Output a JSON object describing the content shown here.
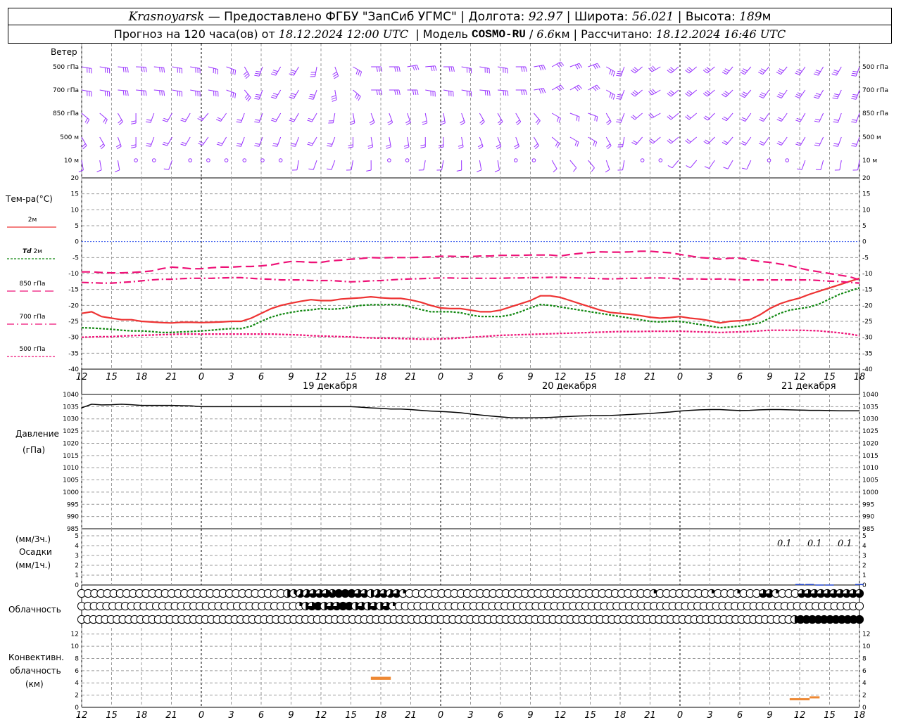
{
  "header": {
    "city": "Krasnoyarsk",
    "provider": " — Предоставлено ФГБУ \"ЗапСиб УГМС\" | Долгота: ",
    "lon": "92.97",
    "lat_label": " | Широта: ",
    "lat": "56.021",
    "alt_label": " | Высота: ",
    "alt": "189",
    "alt_unit": "м",
    "forecast_label": "Прогноз на 120 часа(ов) от ",
    "forecast_from": "18.12.2024 12:00 UTC",
    "model_label": "  | Модель ",
    "model": "COSMO-RU",
    "model_res_sep": " / ",
    "model_res": "6.6",
    "model_res_unit": "км",
    "computed_label": " | Рассчитано: ",
    "computed": "18.12.2024 16:46 UTC"
  },
  "wind_panel": {
    "title": "Ветер",
    "levels": [
      "500 гПа",
      "700 гПа",
      "850 гПа",
      "500 м",
      "10  м"
    ],
    "colors": {
      "barbs": "#9933ff"
    }
  },
  "temp_panel": {
    "title": "Тем-ра(°С)",
    "legend": [
      {
        "label": "2м",
        "color": "#ee3333",
        "dash": ""
      },
      {
        "label_italic": "Td",
        "label": " 2м",
        "color": "#118811",
        "dash": "3,2"
      },
      {
        "label": "850 гПа",
        "color": "#ee1177",
        "dash": "12,6"
      },
      {
        "label": "700 гПа",
        "color": "#ee1177",
        "dash": "10,4,2,4"
      },
      {
        "label": "500 гПа",
        "color": "#ee1177",
        "dash": "3,2"
      }
    ],
    "yticks": [
      "20",
      "15",
      "10",
      "5",
      "0",
      "-5",
      "-10",
      "-15",
      "-20",
      "-25",
      "-30",
      "-35",
      "-40"
    ]
  },
  "day_labels": [
    "19 декабря",
    "20 декабря",
    "21 декабря"
  ],
  "xticks": [
    "12",
    "15",
    "18",
    "21",
    "0",
    "3",
    "6",
    "9",
    "12",
    "15",
    "18",
    "21",
    "0",
    "3",
    "6",
    "9",
    "12",
    "15",
    "18",
    "21",
    "0",
    "3",
    "6",
    "9",
    "12",
    "15",
    "18"
  ],
  "pressure_panel": {
    "title": "Давление",
    "unit": "(гПа)",
    "yticks": [
      "1040",
      "1035",
      "1030",
      "1025",
      "1020",
      "1015",
      "1010",
      "1005",
      "1000",
      "995",
      "990",
      "985"
    ]
  },
  "precip_panel": {
    "unit_top": "(мм/3ч.)",
    "title": "Осадки",
    "unit_bottom": "(мм/1ч.)",
    "yticks": [
      "5",
      "4",
      "3",
      "2",
      "1",
      "0"
    ],
    "labels": [
      "0.1",
      "0.1",
      "0.1"
    ]
  },
  "cloud_panel": {
    "title": "Облачность"
  },
  "conv_panel": {
    "title_1": "Конвективн.",
    "title_2": "облачность",
    "unit": "(км)",
    "yticks": [
      "12",
      "10",
      "8",
      "6",
      "4",
      "2",
      "0"
    ]
  },
  "chart_data": {
    "type": "line",
    "x_hours": [
      0,
      1,
      2,
      3,
      4,
      5,
      6,
      7,
      8,
      9,
      10,
      11,
      12,
      13,
      14,
      15,
      16,
      17,
      18,
      19,
      20,
      21,
      22,
      23,
      24,
      25,
      26,
      27,
      28,
      29,
      30,
      31,
      32,
      33,
      34,
      35,
      36,
      37,
      38,
      39,
      40,
      41,
      42,
      43,
      44,
      45,
      46,
      47,
      48,
      49,
      50,
      51,
      52,
      53,
      54,
      55,
      56,
      57,
      58,
      59,
      60,
      61,
      62,
      63,
      64,
      65,
      66,
      67,
      68,
      69,
      70,
      71,
      72,
      73,
      74,
      75,
      76,
      77,
      78
    ],
    "series": [
      {
        "name": "2м",
        "values": [
          -22.5,
          -22,
          -23.5,
          -24,
          -24.5,
          -24.5,
          -25,
          -25.2,
          -25.4,
          -25.5,
          -25.3,
          -25.3,
          -25.4,
          -25.3,
          -25.2,
          -25,
          -25,
          -24,
          -22.5,
          -21,
          -20,
          -19.3,
          -18.7,
          -18.2,
          -18.5,
          -18.5,
          -18,
          -17.8,
          -17.6,
          -17.3,
          -17.6,
          -17.8,
          -17.8,
          -18.3,
          -19,
          -20,
          -20.8,
          -21,
          -21,
          -21.5,
          -22,
          -22,
          -21.5,
          -20.5,
          -19.5,
          -18.5,
          -17,
          -17,
          -17.5,
          -18.5,
          -19.5,
          -20.5,
          -21.5,
          -22.2,
          -22.5,
          -22.8,
          -23.2,
          -23.7,
          -24,
          -23.8,
          -23.5,
          -24,
          -24.3,
          -24.8,
          -25.5,
          -25,
          -24.8,
          -24.5,
          -23,
          -21,
          -19.5,
          -18.5,
          -17.7,
          -16.5,
          -15.5,
          -14.5,
          -13.5,
          -12.5,
          -11.5
        ],
        "color": "#ee3333"
      },
      {
        "name": "Td 2м",
        "values": [
          -27,
          -27.1,
          -27.3,
          -27.5,
          -27.8,
          -28,
          -28,
          -28.2,
          -28.5,
          -28.5,
          -28.3,
          -28.2,
          -28,
          -27.8,
          -27.5,
          -27.3,
          -27.3,
          -26.5,
          -25,
          -23.7,
          -22.8,
          -22.2,
          -21.7,
          -21.4,
          -21,
          -21.2,
          -21,
          -20.5,
          -20,
          -19.8,
          -19.8,
          -19.7,
          -19.8,
          -20.5,
          -21.3,
          -22,
          -22,
          -22,
          -22.3,
          -23,
          -23.5,
          -23.5,
          -23.5,
          -23,
          -22,
          -20.8,
          -19.7,
          -20,
          -20.5,
          -21,
          -21.5,
          -22,
          -22.5,
          -23,
          -23.5,
          -24,
          -24.5,
          -25,
          -25.2,
          -25,
          -25,
          -25.5,
          -26,
          -26.5,
          -27,
          -26.8,
          -26.5,
          -26,
          -25.5,
          -24,
          -22.5,
          -21.5,
          -21,
          -20.5,
          -19.5,
          -18,
          -16.5,
          -15.5,
          -14.5
        ],
        "color": "#118811"
      },
      {
        "name": "850 гПа",
        "values": [
          -9.5,
          -9.5,
          -9.7,
          -9.8,
          -9.8,
          -9.7,
          -9.5,
          -9.2,
          -8.5,
          -8,
          -8.2,
          -8.5,
          -8.5,
          -8.2,
          -8,
          -8,
          -7.8,
          -7.8,
          -7.6,
          -7.3,
          -6.7,
          -6.2,
          -6.3,
          -6.5,
          -6.5,
          -6,
          -5.8,
          -5.5,
          -5.3,
          -5,
          -5.1,
          -5,
          -5,
          -5,
          -4.9,
          -4.8,
          -4.6,
          -4.6,
          -4.7,
          -4.7,
          -4.5,
          -4.5,
          -4.3,
          -4.3,
          -4.3,
          -4.2,
          -4.2,
          -4.2,
          -4.5,
          -4,
          -3.7,
          -3.4,
          -3.2,
          -3.3,
          -3.3,
          -3.2,
          -3,
          -3,
          -3.3,
          -3.5,
          -4,
          -4.5,
          -5,
          -5.2,
          -5.5,
          -5.2,
          -5.2,
          -5.7,
          -6.2,
          -6.5,
          -7,
          -7.5,
          -8.3,
          -9,
          -9.5,
          -10,
          -10.5,
          -11,
          -12
        ],
        "color": "#ee1177"
      },
      {
        "name": "700 гПа",
        "values": [
          -12.8,
          -12.9,
          -13,
          -13,
          -12.8,
          -12.6,
          -12.3,
          -12,
          -11.8,
          -11.8,
          -11.6,
          -11.5,
          -11.5,
          -11.5,
          -11.4,
          -11.3,
          -11.3,
          -11.5,
          -11.7,
          -11.8,
          -12,
          -12,
          -12,
          -12.2,
          -12.2,
          -12.2,
          -12.4,
          -12.6,
          -12.5,
          -12.3,
          -12.2,
          -12,
          -11.8,
          -11.7,
          -11.6,
          -11.5,
          -11.4,
          -11.4,
          -11.5,
          -11.5,
          -11.5,
          -11.5,
          -11.5,
          -11.4,
          -11.4,
          -11.3,
          -11.3,
          -11.2,
          -11.2,
          -11.3,
          -11.4,
          -11.5,
          -11.6,
          -11.7,
          -11.6,
          -11.5,
          -11.5,
          -11.4,
          -11.4,
          -11.5,
          -11.7,
          -11.7,
          -11.7,
          -11.8,
          -11.7,
          -11.8,
          -12,
          -12,
          -12,
          -12,
          -12,
          -12,
          -12,
          -12,
          -12.2,
          -12.4,
          -12.5,
          -12.8,
          -13
        ],
        "color": "#ee1177"
      },
      {
        "name": "500 гПа",
        "values": [
          -30,
          -29.9,
          -29.8,
          -29.8,
          -29.6,
          -29.5,
          -29.4,
          -29.3,
          -29.2,
          -29.1,
          -29,
          -29,
          -29,
          -29,
          -29,
          -29,
          -29,
          -29,
          -29,
          -29,
          -29.1,
          -29.2,
          -29.3,
          -29.5,
          -29.6,
          -29.7,
          -29.8,
          -29.9,
          -30.1,
          -30.2,
          -30.3,
          -30.3,
          -30.4,
          -30.5,
          -30.6,
          -30.6,
          -30.5,
          -30.4,
          -30.2,
          -30,
          -29.8,
          -29.6,
          -29.4,
          -29.3,
          -29.2,
          -29.1,
          -29,
          -28.9,
          -28.8,
          -28.7,
          -28.6,
          -28.5,
          -28.4,
          -28.3,
          -28.2,
          -28.2,
          -28.2,
          -28.1,
          -28.1,
          -28.1,
          -28.1,
          -28.2,
          -28.3,
          -28.4,
          -28.5,
          -28.4,
          -28.3,
          -28.2,
          -28,
          -27.8,
          -27.8,
          -27.8,
          -27.8,
          -27.9,
          -28,
          -28.3,
          -28.6,
          -29,
          -29.5
        ],
        "color": "#ee1177"
      }
    ],
    "pressure": [
      1034.5,
      1036,
      1035.7,
      1035.8,
      1036,
      1035.8,
      1035.5,
      1035.5,
      1035.5,
      1035.5,
      1035.4,
      1035.3,
      1035,
      1035,
      1035,
      1035,
      1035,
      1035,
      1035,
      1035,
      1035,
      1035,
      1035,
      1035,
      1035,
      1035,
      1035,
      1035,
      1034.8,
      1034.5,
      1034.3,
      1034,
      1034,
      1033.8,
      1033.5,
      1033.2,
      1033,
      1032.8,
      1032.5,
      1032,
      1031.6,
      1031.2,
      1030.8,
      1030.5,
      1030.4,
      1030.4,
      1030.5,
      1030.6,
      1030.8,
      1031,
      1031.2,
      1031.3,
      1031.3,
      1031.4,
      1031.6,
      1031.8,
      1032,
      1032.2,
      1032.5,
      1032.8,
      1033.2,
      1033.5,
      1033.7,
      1033.8,
      1033.8,
      1033.6,
      1033.4,
      1033.5,
      1033.7,
      1033.8,
      1033.8,
      1033.7,
      1033.6,
      1033.5,
      1033.5,
      1033.4,
      1033.3,
      1033.3,
      1033.3
    ],
    "precip_1h": [
      {
        "h": 72,
        "v": 0.1
      },
      {
        "h": 73,
        "v": 0.1
      },
      {
        "h": 74,
        "v": 0.05
      },
      {
        "h": 75,
        "v": 0.05
      },
      {
        "h": 78,
        "v": 0.1
      }
    ],
    "conv_cloud": [
      {
        "h_start": 29,
        "h_end": 31,
        "base_km": 4.5,
        "top_km": 5
      },
      {
        "h_start": 71,
        "h_end": 73,
        "base_km": 1.2,
        "top_km": 1.5
      },
      {
        "h_start": 73,
        "h_end": 74,
        "base_km": 1.5,
        "top_km": 1.8
      }
    ],
    "clouds_okta_rows": [
      [
        0,
        0,
        0,
        0,
        0,
        0,
        0,
        0,
        0,
        0,
        0,
        0,
        0,
        0,
        0,
        0,
        0,
        0,
        0,
        0,
        0,
        0,
        0,
        0,
        0,
        0,
        0,
        0,
        0,
        0,
        0,
        0,
        4,
        3,
        5,
        5,
        6,
        6,
        6,
        7,
        8,
        8,
        8,
        6,
        6,
        4,
        5,
        6,
        5,
        6,
        2,
        0,
        0,
        0,
        0,
        0,
        0,
        0,
        0,
        0,
        0,
        0,
        0,
        0,
        0,
        0,
        0,
        0,
        0,
        0,
        0,
        0,
        0,
        0,
        0,
        0,
        0,
        0,
        0,
        0,
        0,
        0,
        0,
        0,
        0,
        0,
        0,
        0,
        0,
        2,
        0,
        0,
        0,
        0,
        0,
        0,
        0,
        0,
        2,
        0,
        0,
        0,
        2,
        0,
        0,
        0,
        6,
        6,
        2,
        0,
        0,
        0,
        6,
        6,
        6,
        6,
        6,
        6,
        6,
        6,
        6,
        6
      ],
      [
        0,
        0,
        0,
        0,
        0,
        0,
        0,
        0,
        0,
        0,
        0,
        0,
        0,
        0,
        0,
        0,
        0,
        0,
        0,
        0,
        0,
        0,
        0,
        0,
        0,
        0,
        0,
        0,
        0,
        0,
        0,
        0,
        0,
        0,
        0,
        2,
        4,
        6,
        8,
        4,
        6,
        6,
        8,
        8,
        4,
        6,
        4,
        6,
        4,
        6,
        2,
        0,
        0,
        0,
        0,
        0,
        0,
        0,
        0,
        0,
        0,
        0,
        0,
        0,
        0,
        0,
        0,
        0,
        0,
        0,
        0,
        0,
        0,
        0,
        0,
        0,
        0,
        0,
        0,
        0,
        0,
        0,
        0,
        0,
        0,
        0,
        0,
        0,
        0,
        0,
        0,
        0,
        0,
        0,
        0,
        0,
        0,
        0,
        0,
        0,
        0,
        0,
        0,
        0,
        0,
        0,
        0,
        0,
        0,
        0,
        0,
        0,
        0,
        0,
        0,
        0,
        0,
        0,
        0,
        0,
        0,
        0,
        0,
        0,
        0,
        0
      ],
      [
        0,
        0,
        0,
        0,
        0,
        0,
        0,
        0,
        0,
        0,
        0,
        0,
        0,
        0,
        0,
        0,
        0,
        0,
        0,
        0,
        0,
        0,
        0,
        0,
        0,
        0,
        0,
        0,
        0,
        0,
        0,
        0,
        0,
        0,
        0,
        0,
        0,
        0,
        0,
        0,
        0,
        0,
        0,
        0,
        0,
        0,
        0,
        0,
        0,
        0,
        0,
        0,
        0,
        0,
        0,
        0,
        0,
        0,
        0,
        0,
        0,
        0,
        0,
        0,
        0,
        0,
        0,
        0,
        0,
        0,
        0,
        0,
        0,
        0,
        0,
        0,
        0,
        0,
        0,
        0,
        0,
        0,
        0,
        0,
        0,
        0,
        0,
        0,
        0,
        0,
        0,
        0,
        0,
        0,
        0,
        0,
        0,
        0,
        0,
        0,
        0,
        0,
        0,
        0,
        0,
        0,
        0,
        0,
        0,
        0,
        0,
        0,
        0,
        0,
        0,
        0,
        0,
        0,
        0,
        0,
        0,
        4,
        8,
        8,
        8,
        8,
        8,
        8,
        8,
        8,
        8,
        8,
        8
      ]
    ],
    "ylim_temp": [
      -40,
      20
    ],
    "ylim_pressure": [
      985,
      1040
    ],
    "ylim_precip": [
      0,
      5
    ],
    "ylim_conv": [
      0,
      13
    ]
  }
}
